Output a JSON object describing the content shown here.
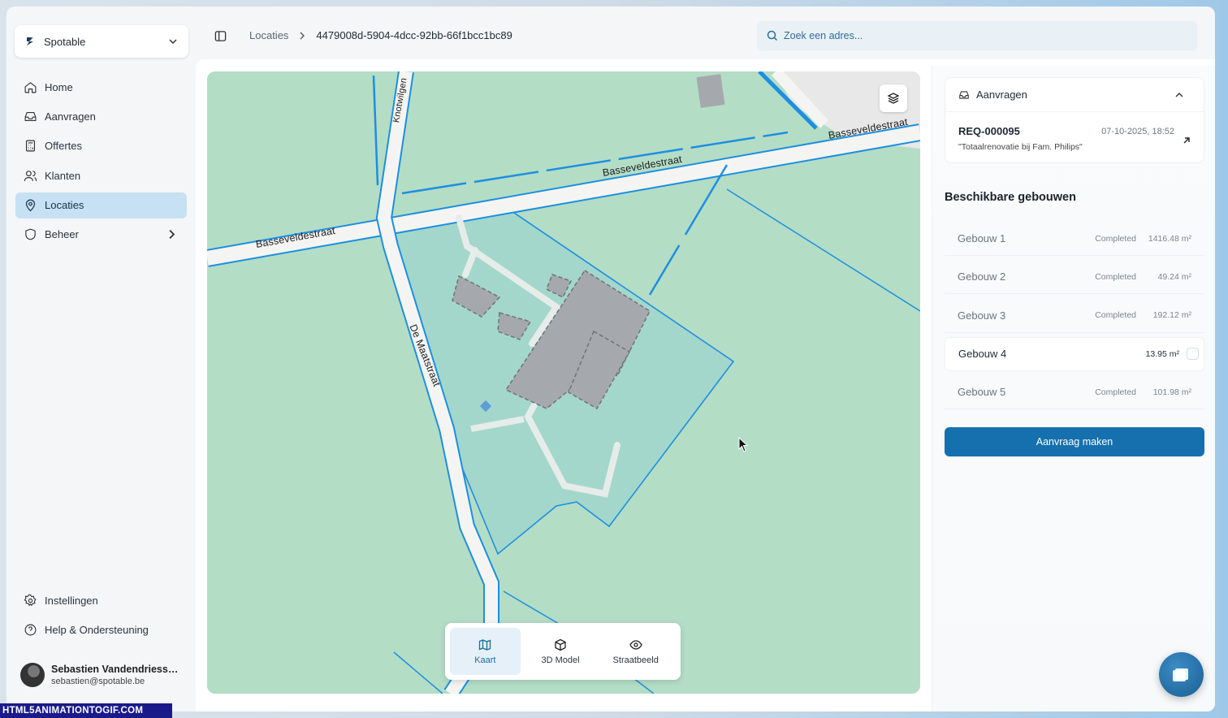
{
  "org": {
    "name": "Spotable"
  },
  "nav": {
    "items": [
      {
        "label": "Home",
        "icon": "home-icon"
      },
      {
        "label": "Aanvragen",
        "icon": "inbox-icon"
      },
      {
        "label": "Offertes",
        "icon": "calculator-icon"
      },
      {
        "label": "Klanten",
        "icon": "users-icon"
      },
      {
        "label": "Locaties",
        "icon": "map-pin-icon",
        "active": true
      },
      {
        "label": "Beheer",
        "icon": "shield-icon",
        "has_children": true
      }
    ],
    "bottom": [
      {
        "label": "Instellingen",
        "icon": "gear-icon"
      },
      {
        "label": "Help & Ondersteuning",
        "icon": "help-circle-icon"
      }
    ]
  },
  "user": {
    "name": "Sebastien Vandendriessche",
    "email": "sebastien@spotable.be"
  },
  "breadcrumb": {
    "parent": "Locaties",
    "current": "4479008d-5904-4dcc-92bb-66f1bcc1bc89"
  },
  "search": {
    "placeholder": "Zoek een adres..."
  },
  "map": {
    "streets": {
      "s1": "Basseveldestraat",
      "s2": "Basseveldestraat",
      "s3": "Basseveldestraat",
      "s4": "Knotwilgen",
      "s5": "De Maatstraat"
    },
    "toolbar": {
      "kaart": "Kaart",
      "model3d": "3D Model",
      "straatbeeld": "Straatbeeld"
    },
    "active_view": "Kaart"
  },
  "requests": {
    "header": "Aanvragen",
    "item": {
      "id": "REQ-000095",
      "date": "07-10-2025, 18:52",
      "description": "\"Totaalrenovatie bij Fam. Philips\""
    }
  },
  "buildings": {
    "title": "Beschikbare gebouwen",
    "rows": [
      {
        "name": "Gebouw 1",
        "status": "Completed",
        "area": "1416.48 m²"
      },
      {
        "name": "Gebouw 2",
        "status": "Completed",
        "area": "49.24 m²"
      },
      {
        "name": "Gebouw 3",
        "status": "Completed",
        "area": "192.12 m²"
      },
      {
        "name": "Gebouw 4",
        "status": "",
        "area": "13.95 m²",
        "selected": true
      },
      {
        "name": "Gebouw 5",
        "status": "Completed",
        "area": "101.98 m²"
      }
    ],
    "cta": "Aanvraag maken"
  },
  "watermark": "HTML5ANIMATIONTOGIF.COM",
  "colors": {
    "accent": "#1670ad",
    "active_nav": "#c6e1f3",
    "map_green": "#b5dec7",
    "parcel_line": "#1d8fe0"
  }
}
